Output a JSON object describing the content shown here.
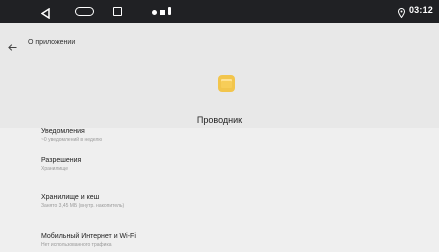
{
  "status_bar": {
    "time": "03:12",
    "icons": [
      "back-triangle-icon",
      "home-pill-icon",
      "recent-square-icon",
      "notification-icons",
      "location-icon"
    ]
  },
  "header": {
    "title": "О приложении"
  },
  "app": {
    "name": "Проводник",
    "icon": "folder-icon"
  },
  "settings": [
    {
      "title": "Уведомления",
      "subtitle": "~0 уведомлений в неделю"
    },
    {
      "title": "Разрешения",
      "subtitle": "Хранилище"
    },
    {
      "title": "Хранилище и кеш",
      "subtitle": "Занято 3,45 МБ (внутр. накопитель)"
    },
    {
      "title": "Мобильный Интернет и Wi-Fi",
      "subtitle": "Нет использованного трафика"
    }
  ]
}
